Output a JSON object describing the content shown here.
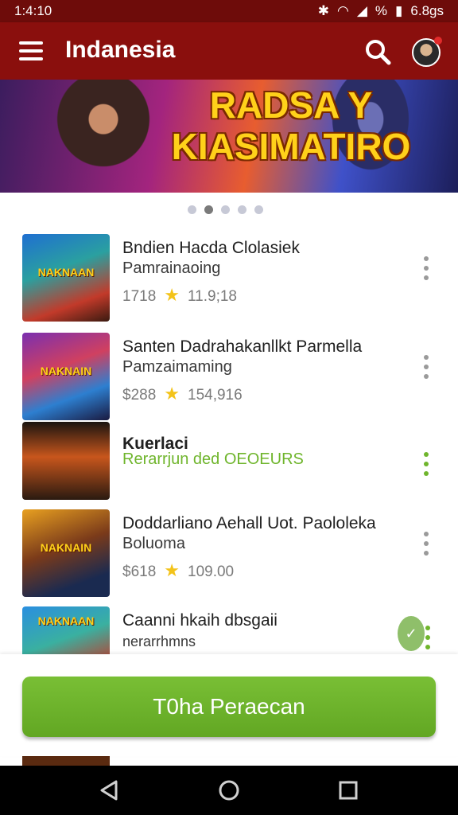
{
  "status_bar": {
    "time": "1:4:10",
    "battery_text": "6.8gs",
    "signal_text": "%"
  },
  "app_bar": {
    "title": "Indanesia"
  },
  "banner": {
    "line1": "RADSA Y",
    "line2": "KIASIMATIRO"
  },
  "carousel": {
    "total_dots": 5,
    "active_index": 1
  },
  "items": [
    {
      "title": "Bndien Hacda Clolasiek",
      "subtitle": "Pamrainaoing",
      "price": "1718",
      "rating": "11.9;18",
      "thumb_text": "NAKNAAN",
      "variant": "normal"
    },
    {
      "title": "Santen Dadrahakanllkt Parmella",
      "subtitle": "Pamzaimaming",
      "price": "$288",
      "rating": "154,916",
      "thumb_text": "NAKNAIN",
      "variant": "normal"
    },
    {
      "title": "Kuerlaci",
      "subtitle": "Rerarrjun  ded  OEOEURS",
      "price": "",
      "rating": "",
      "thumb_text": "",
      "variant": "green"
    },
    {
      "title": "Doddarliano Aehall Uot. Paololeka",
      "subtitle": "Boluoma",
      "price": "$618",
      "rating": "109.00",
      "thumb_text": "NAKNAIN",
      "variant": "normal"
    },
    {
      "title": "Caanni hkaih dbsgaii",
      "subtitle": "nerarrhmns",
      "price": "",
      "rating": "",
      "thumb_text": "NAKNAAN",
      "variant": "partial"
    }
  ],
  "cta": {
    "label": "T0ha Peraecan"
  },
  "colors": {
    "primary": "#8a0f0d",
    "accent_green": "#6fb52c",
    "star": "#f3c31a"
  }
}
